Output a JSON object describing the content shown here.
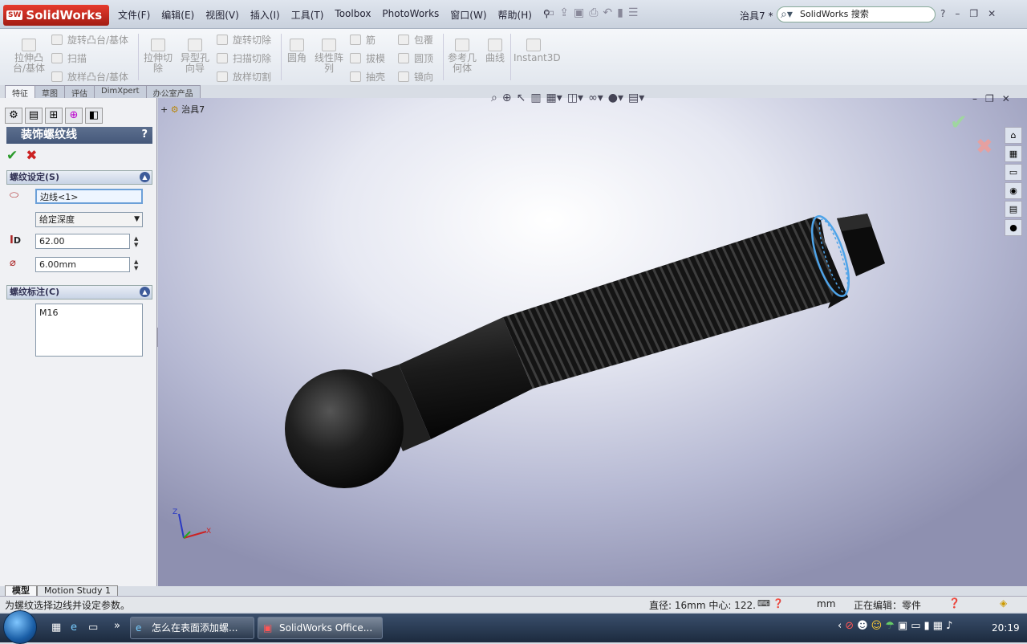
{
  "app": {
    "logo_badge": "SW",
    "logo_text": "SolidWorks",
    "document_title": "治具7 *"
  },
  "menu": [
    "文件(F)",
    "编辑(E)",
    "视图(V)",
    "插入(I)",
    "工具(T)",
    "Toolbox",
    "PhotoWorks",
    "窗口(W)",
    "帮助(H)"
  ],
  "search": {
    "placeholder": "SolidWorks 搜索"
  },
  "window_controls": {
    "help": "?",
    "minimize": "–",
    "restore": "❐",
    "close": "✕"
  },
  "command_manager": {
    "large": [
      {
        "label": "拉伸凸\n台/基体"
      },
      {
        "label": "拉伸切\n除"
      },
      {
        "label": "异型孔\n向导"
      },
      {
        "label": "圆角"
      },
      {
        "label": "线性阵\n列"
      },
      {
        "label": "参考几\n何体"
      },
      {
        "label": "曲线"
      },
      {
        "label": "Instant3D"
      }
    ],
    "small": [
      "旋转凸台/基体",
      "扫描",
      "放样凸台/基体",
      "旋转切除",
      "扫描切除",
      "放样切割",
      "筋",
      "拔模",
      "抽壳",
      "包覆",
      "圆顶",
      "镜向"
    ]
  },
  "tabs": [
    "特征",
    "草图",
    "评估",
    "DimXpert",
    "办公室产品"
  ],
  "feature_tree": {
    "root": "治具7"
  },
  "property_manager": {
    "title": "装饰螺纹线",
    "help": "?",
    "thread_settings": {
      "header": "螺纹设定(S)",
      "edge": "边线<1>",
      "end_condition": "给定深度",
      "depth_icon_label": "D",
      "depth": "62.00",
      "diameter": "6.00mm"
    },
    "thread_callout": {
      "header": "螺纹标注(C)",
      "text": "M16"
    }
  },
  "model_tabs": [
    "模型",
    "Motion Study 1"
  ],
  "status": {
    "hint": "为螺纹选择边线并设定参数。",
    "measure": "直径: 16mm  中心: 122.",
    "unit_tail": "mm",
    "mode": "正在编辑：零件"
  },
  "taskbar": {
    "items": [
      "怎么在表面添加螺...",
      "SolidWorks Office..."
    ],
    "clock": "20:19"
  },
  "colors": {
    "accent": "#3e5c9a",
    "title_red": "#c1281c",
    "selection": "#4ea3e8",
    "model": "#1a1a1a"
  }
}
